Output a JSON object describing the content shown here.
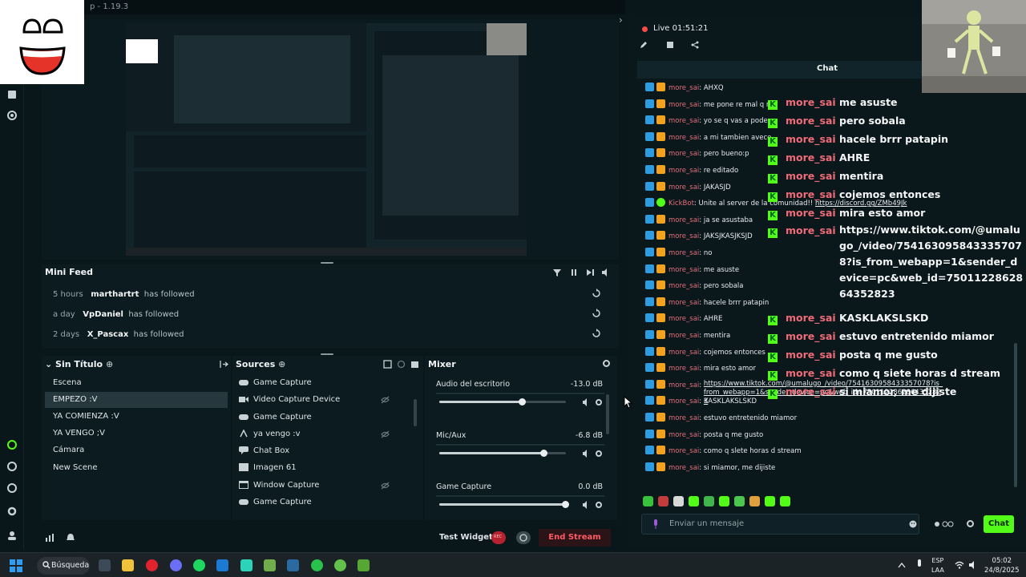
{
  "window": {
    "title_fragment": "p - 1.19.3"
  },
  "live": {
    "label": "Live 01:51:21"
  },
  "mini_feed": {
    "title": "Mini Feed",
    "events": [
      {
        "age": "5 hours",
        "name": "marthartrt",
        "action": "has followed"
      },
      {
        "age": "a day",
        "name": "VpDaniel",
        "action": "has followed"
      },
      {
        "age": "2 days",
        "name": "X_Pascax",
        "action": "has followed"
      }
    ]
  },
  "scenes": {
    "title": "Sin Título",
    "items": [
      "Escena",
      "EMPEZO :V",
      "YA COMIENZA :V",
      "YA VENGO ;V",
      "Cámara",
      "New Scene"
    ],
    "active_index": 1
  },
  "sources": {
    "title": "Sources",
    "items": [
      {
        "label": "Game Capture",
        "icon": "gamepad-icon"
      },
      {
        "label": "Video Capture Device",
        "icon": "camera-icon"
      },
      {
        "label": "Game Capture",
        "icon": "gamepad-icon"
      },
      {
        "label": "ya vengo :v",
        "icon": "text-icon"
      },
      {
        "label": "Chat Box",
        "icon": "chat-icon"
      },
      {
        "label": "Imagen 61",
        "icon": "image-icon"
      },
      {
        "label": "Window Capture",
        "icon": "window-icon"
      },
      {
        "label": "Game Capture",
        "icon": "gamepad-icon"
      }
    ]
  },
  "mixer": {
    "title": "Mixer",
    "channels": [
      {
        "name": "Audio del escritorio",
        "db": "-13.0 dB",
        "level": 0.66
      },
      {
        "name": "Mic/Aux",
        "db": "-6.8 dB",
        "level": 0.83
      },
      {
        "name": "Game Capture",
        "db": "0.0 dB",
        "level": 1.0
      }
    ]
  },
  "footer": {
    "test_widgets": "Test Widgets",
    "rec": "REC",
    "end_stream": "End Stream"
  },
  "chat": {
    "title": "Chat",
    "messages": [
      {
        "user": "more_sai",
        "text": "AHXQ"
      },
      {
        "user": "more_sai",
        "text": "me pone re mal q n"
      },
      {
        "user": "more_sai",
        "text": "yo se q vas a poder"
      },
      {
        "user": "more_sai",
        "text": "a mi tambien avece"
      },
      {
        "user": "more_sai",
        "text": "pero bueno:p"
      },
      {
        "user": "more_sai",
        "text": "re editado"
      },
      {
        "user": "more_sai",
        "text": "JAKASJD"
      },
      {
        "user": "KickBot",
        "text": "Unite al server de la comunidad!! ",
        "link": "https://discord.gg/ZMb49Jk"
      },
      {
        "user": "more_sai",
        "text": "ja se asustaba"
      },
      {
        "user": "more_sai",
        "text": "JAKSJKASJKSJD"
      },
      {
        "user": "more_sai",
        "text": "no"
      },
      {
        "user": "more_sai",
        "text": "me asuste"
      },
      {
        "user": "more_sai",
        "text": "pero sobala"
      },
      {
        "user": "more_sai",
        "text": "hacele brrr patapin"
      },
      {
        "user": "more_sai",
        "text": "AHRE"
      },
      {
        "user": "more_sai",
        "text": "mentira"
      },
      {
        "user": "more_sai",
        "text": "cojemos entonces"
      },
      {
        "user": "more_sai",
        "text": "mira esto amor"
      },
      {
        "user": "more_sai",
        "text": "",
        "link": "https://www.tiktok.com/@umalugo_/video/7541630958433357078?is_from_webapp=1&sender_device=pc&web_id=7501122862864352823"
      },
      {
        "user": "more_sai",
        "text": "KASKLAKSLSKD"
      },
      {
        "user": "more_sai",
        "text": "estuvo entretenido miamor"
      },
      {
        "user": "more_sai",
        "text": "posta q me gusto"
      },
      {
        "user": "more_sai",
        "text": "como q slete horas d stream"
      },
      {
        "user": "more_sai",
        "text": "si miamor, me dijiste"
      }
    ],
    "input_placeholder": "Enviar un mensaje",
    "send_label": "Chat"
  },
  "overlay_chat": {
    "messages": [
      {
        "user": "more_sai",
        "text": "me asuste"
      },
      {
        "user": "more_sai",
        "text": "pero sobala"
      },
      {
        "user": "more_sai",
        "text": "hacele brrr patapin"
      },
      {
        "user": "more_sai",
        "text": "AHRE"
      },
      {
        "user": "more_sai",
        "text": "mentira"
      },
      {
        "user": "more_sai",
        "text": "cojemos entonces"
      },
      {
        "user": "more_sai",
        "text": "mira esto amor"
      }
    ],
    "link_message": {
      "user": "more_sai",
      "text": "https://www.tiktok.com/@umalugo_/video/7541630958433357078?is_from_webapp=1&sender_device=pc&web_id=7501122862864352823"
    },
    "tail": [
      {
        "user": "more_sai",
        "text": "KASKLAKSLSKD"
      },
      {
        "user": "more_sai",
        "text": "estuvo entretenido miamor"
      },
      {
        "user": "more_sai",
        "text": "posta q me gusto"
      },
      {
        "user": "more_sai",
        "text": "como q siete horas d stream"
      },
      {
        "user": "more_sai",
        "text": "si miamor, me dijiste"
      }
    ]
  },
  "taskbar": {
    "search_label": "Búsqueda",
    "lang_top": "ESP",
    "lang_bottom": "LAA",
    "time": "05:02",
    "date": "24/8/2025"
  },
  "colors": {
    "accent_green": "#53fc18",
    "username_red": "#e46f7a",
    "end_stream_red": "#ff5a63"
  }
}
